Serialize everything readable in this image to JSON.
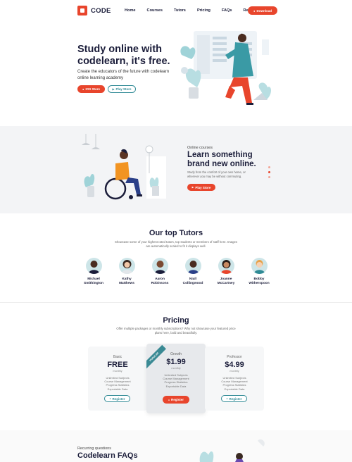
{
  "brand": "CODE",
  "nav": {
    "links": [
      "Home",
      "Courses",
      "Tutors",
      "Pricing",
      "FAQs",
      "Reviews"
    ],
    "download": "Download"
  },
  "hero": {
    "title": "Study online with codelearn, it's free.",
    "subtitle": "Create the educators of the future with codelearn online learning academy",
    "ios": "IOS Store",
    "play": "Play Store"
  },
  "online": {
    "eyebrow": "Online courses",
    "title": "Learn something brand new online.",
    "text": "Study from the comfort of your own home, or wherever you may be without commuting.",
    "play": "Play Store"
  },
  "tutors": {
    "title": "Our top Tutors",
    "desc": "Showcase some of your highest rated tutors, top students or members of staff here. Images are automatically scaled to fit it displays well.",
    "people": [
      {
        "first": "Michael",
        "last": "Smithington"
      },
      {
        "first": "Kathy",
        "last": "Matthews"
      },
      {
        "first": "Aaron",
        "last": "Robinsons"
      },
      {
        "first": "Niall",
        "last": "Collingwood"
      },
      {
        "first": "Joanne",
        "last": "McCartney"
      },
      {
        "first": "Bobby",
        "last": "Witherspoon"
      }
    ]
  },
  "pricing": {
    "title": "Pricing",
    "desc": "Offer multiple packages or monthly subscriptions? Why not showcase your featured price plans here, bold and beautifully.",
    "popular": "POPULAR",
    "plans": [
      {
        "name": "Basic",
        "price": "FREE",
        "per": "monthly",
        "features": [
          "Unlimited Subjects",
          "Course Management",
          "Progress Statistics",
          "Exportable Data"
        ],
        "cta": "Register"
      },
      {
        "name": "Growth",
        "price": "$1.99",
        "per": "monthly",
        "features": [
          "Unlimited Subjects",
          "Course Management",
          "Progress Statistics",
          "Exportable Data"
        ],
        "cta": "Register"
      },
      {
        "name": "Professor",
        "price": "$4.99",
        "per": "monthly",
        "features": [
          "Unlimited Subjects",
          "Course Management",
          "Progress Statistics",
          "Exportable Data"
        ],
        "cta": "Register"
      }
    ]
  },
  "faq": {
    "eyebrow": "Recurring questions",
    "title": "Codelearn FAQs"
  },
  "colors": {
    "accent": "#e8452c",
    "teal": "#2f8a95",
    "navy": "#1b1d3a"
  }
}
